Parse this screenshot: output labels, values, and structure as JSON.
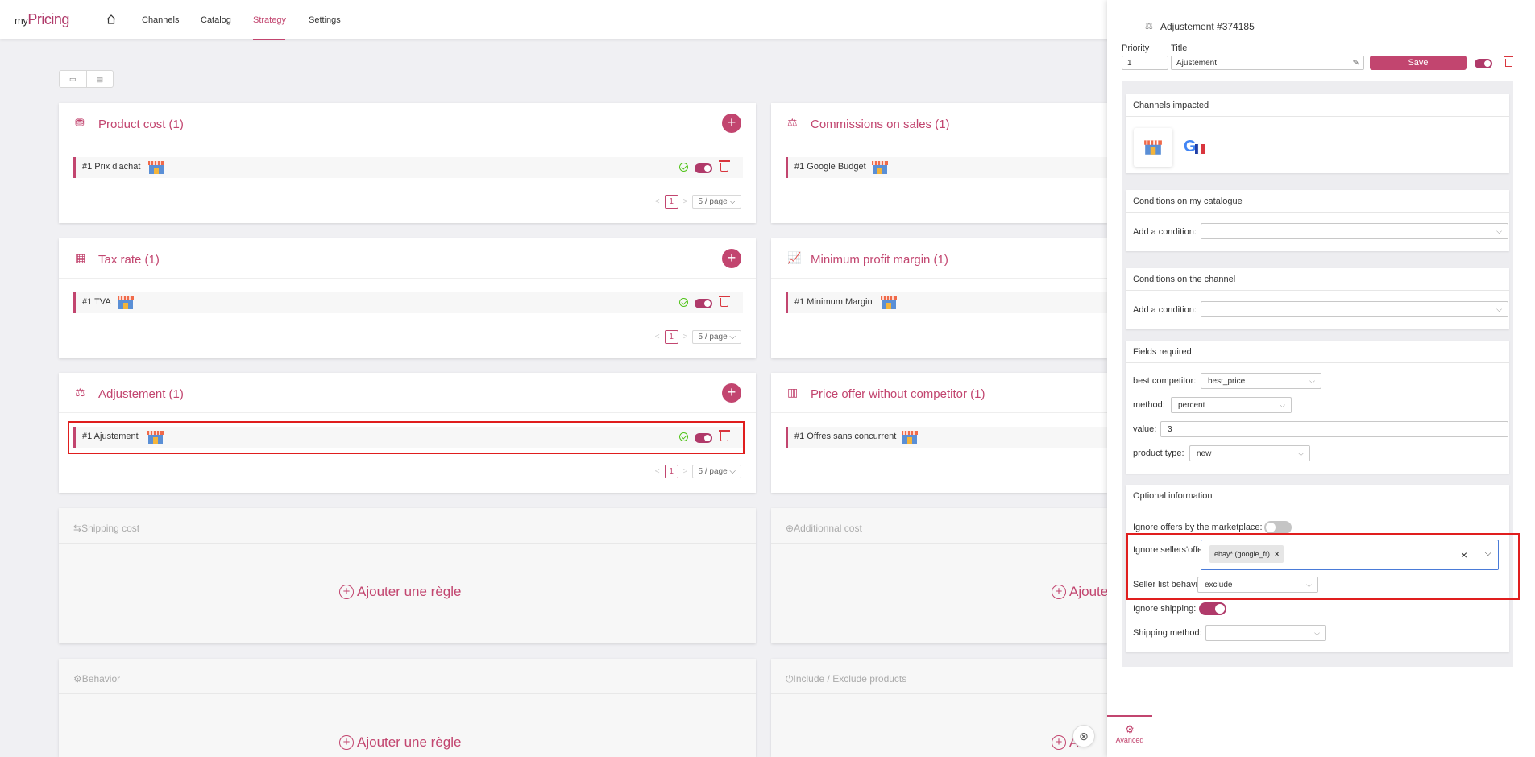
{
  "app": {
    "logo_prefix": "my",
    "logo_main": "Pricing"
  },
  "nav": {
    "items": [
      "Channels",
      "Catalog",
      "Strategy",
      "Settings"
    ],
    "active": "Strategy"
  },
  "cards": {
    "product_cost": {
      "title": "Product cost (1)",
      "rule": "#1  Prix d'achat",
      "page": "1",
      "page_size": "5 / page"
    },
    "commissions": {
      "title": "Commissions on sales (1)",
      "rule": "#1  Google Budget"
    },
    "tax_rate": {
      "title": "Tax rate (1)",
      "rule": "#1  TVA",
      "page": "1",
      "page_size": "5 / page"
    },
    "min_margin": {
      "title": "Minimum profit margin (1)",
      "rule": "#1  Minimum Margin"
    },
    "adjustement": {
      "title": "Adjustement (1)",
      "rule": "#1  Ajustement",
      "page": "1",
      "page_size": "5 / page"
    },
    "no_competitor": {
      "title": "Price offer without competitor (1)",
      "rule": "#1  Offres sans concurrent"
    },
    "shipping": {
      "title": "Shipping cost",
      "add": "Ajouter une règle"
    },
    "additional": {
      "title": "Additionnal cost",
      "add": "Ajoute"
    },
    "behavior": {
      "title": "Behavior",
      "add": "Ajouter une règle"
    },
    "include_exclude": {
      "title": "Include / Exclude products",
      "add": "A"
    }
  },
  "drawer": {
    "title": "Adjustement #374185",
    "priority_label": "Priority",
    "priority_value": "1",
    "title_label": "Title",
    "title_value": "Ajustement",
    "save_label": "Save",
    "channels_header": "Channels impacted",
    "cond_catalogue_header": "Conditions on my catalogue",
    "cond_channel_header": "Conditions on the channel",
    "add_condition_label": "Add a condition:",
    "fields_header": "Fields required",
    "best_competitor_label": "best competitor:",
    "best_competitor_value": "best_price",
    "method_label": "method:",
    "method_value": "percent",
    "value_label": "value:",
    "value_value": "3",
    "product_type_label": "product type:",
    "product_type_value": "new",
    "optional_header": "Optional information",
    "ignore_marketplace_label": "Ignore offers by the marketplace:",
    "ignore_sellers_label": "Ignore sellers'offers:",
    "seller_tag": "ebay* (google_fr)",
    "seller_behavior_label": "Seller list behavior:",
    "seller_behavior_value": "exclude",
    "ignore_shipping_label": "Ignore shipping:",
    "shipping_method_label": "Shipping method:",
    "footer_tab": "Avanced"
  },
  "colors": {
    "accent": "#c2456f",
    "highlight": "#e01e1e"
  }
}
